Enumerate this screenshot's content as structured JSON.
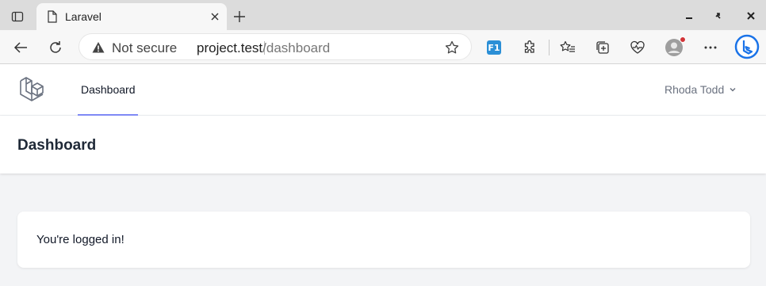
{
  "browser": {
    "tab_title": "Laravel",
    "security_label": "Not secure",
    "url_host": "project.test",
    "url_path": "/dashboard",
    "extension_label": "F1",
    "icons": {
      "tab_actions": "tab-actions-icon",
      "favicon": "page-icon",
      "tab_close": "close-icon",
      "new_tab": "plus-icon",
      "minimize": "minimize-icon",
      "restore": "restore-icon",
      "close_window": "close-icon",
      "back": "back-arrow-icon",
      "refresh": "refresh-icon",
      "warning": "warning-icon",
      "favorite": "star-icon",
      "extensions": "puzzle-icon",
      "favorites": "favorites-icon",
      "collections": "collections-icon",
      "performance": "heartbeat-icon",
      "profile": "avatar-icon",
      "more": "more-icon",
      "copilot": "bing-icon"
    },
    "colors": {
      "notification_dot": "#d13438",
      "extension_blue": "#2b8fd6"
    }
  },
  "app": {
    "nav": {
      "dashboard_link": "Dashboard",
      "user_name": "Rhoda Todd"
    },
    "header": {
      "title": "Dashboard"
    },
    "card": {
      "message": "You're logged in!"
    },
    "colors": {
      "accent": "#818cf8",
      "logo": "#6b7280"
    }
  }
}
